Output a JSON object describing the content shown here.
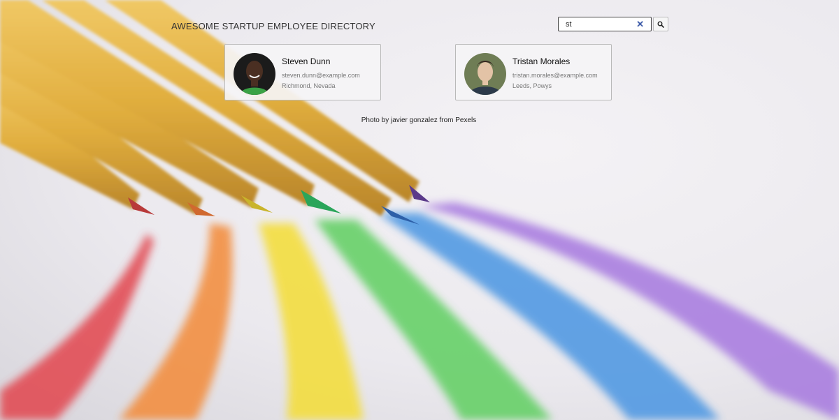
{
  "page": {
    "title": "AWESOME STARTUP EMPLOYEE DIRECTORY",
    "photo_credit": "Photo by javier gonzalez from Pexels"
  },
  "search": {
    "value": "st",
    "clear_icon": "close-icon",
    "submit_icon": "search-icon"
  },
  "employees": [
    {
      "name": "Steven Dunn",
      "email": "steven.dunn@example.com",
      "location": "Richmond, Nevada"
    },
    {
      "name": "Tristan Morales",
      "email": "tristan.morales@example.com",
      "location": "Leeds, Powys"
    }
  ],
  "colors": {
    "clear_icon": "#3d5ba9",
    "card_border": "#b9b9b9"
  }
}
